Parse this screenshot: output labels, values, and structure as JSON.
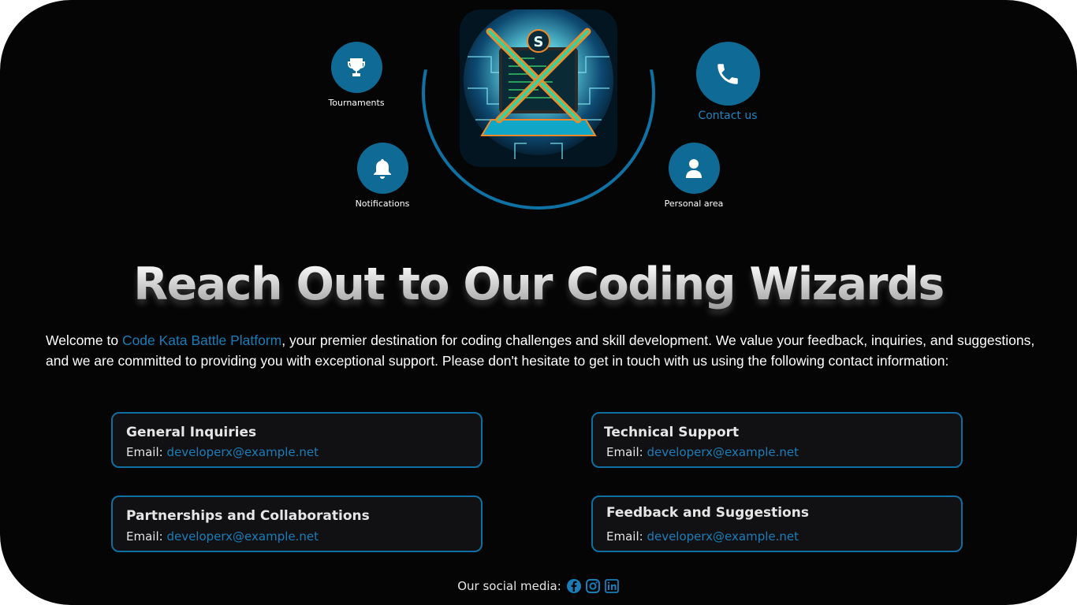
{
  "nav": {
    "tournaments": {
      "label": "Tournaments",
      "icon": "trophy-icon"
    },
    "notifications": {
      "label": "Notifications",
      "icon": "bell-icon"
    },
    "contact": {
      "label": "Contact us",
      "icon": "phone-icon"
    },
    "personal": {
      "label": "Personal area",
      "icon": "user-icon"
    },
    "logo": {
      "icon": "crossed-swords-laptop-logo"
    }
  },
  "page": {
    "title": "Reach Out to Our Coding Wizards",
    "intro_prefix": "Welcome to ",
    "intro_link": "Code Kata Battle Platform",
    "intro_suffix": ", your premier destination for coding challenges and skill development. We value your feedback, inquiries, and suggestions, and we are committed to providing you with exceptional support. Please don't hesitate to get in touch with us using the following contact information:"
  },
  "cards": [
    {
      "title": "General Inquiries",
      "email_label": "Email: ",
      "email": "developerx@example.net"
    },
    {
      "title": "Technical Support",
      "email_label": "Email: ",
      "email": "developerx@example.net"
    },
    {
      "title": "Partnerships and Collaborations",
      "email_label": "Email: ",
      "email": "developerx@example.net"
    },
    {
      "title": "Feedback and Suggestions",
      "email_label": "Email: ",
      "email": "developerx@example.net"
    }
  ],
  "social": {
    "label": "Our social media:",
    "icons": [
      "facebook-icon",
      "instagram-icon",
      "linkedin-icon"
    ]
  },
  "colors": {
    "accent": "#0f6b96",
    "link": "#1a7db8",
    "background": "#050505"
  }
}
